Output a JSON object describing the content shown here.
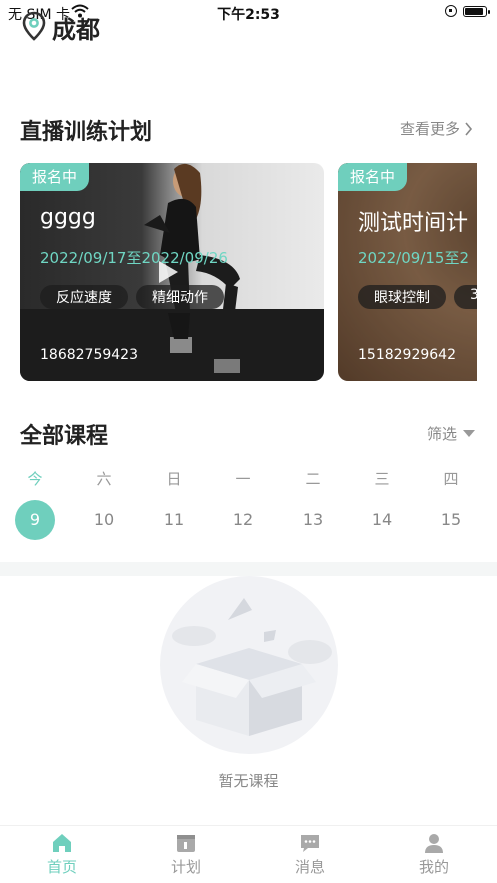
{
  "status_bar": {
    "carrier": "无 SIM 卡",
    "time": "下午2:53",
    "battery_level": 0.9
  },
  "header": {
    "city": "成都",
    "city_icon": "location-pin-icon"
  },
  "live_section": {
    "title": "直播训练计划",
    "see_more": "查看更多",
    "cards": [
      {
        "badge": "报名中",
        "title": "gggg",
        "date": "2022/09/17至2022/09/26",
        "tags": [
          "反应速度",
          "精细动作"
        ],
        "phone": "18682759423"
      },
      {
        "badge": "报名中",
        "title": "测试时间计",
        "date": "2022/09/15至2",
        "tags": [
          "眼球控制",
          "3"
        ],
        "phone": "15182929642"
      }
    ]
  },
  "courses_section": {
    "title": "全部课程",
    "filter": "筛选"
  },
  "calendar": {
    "weekdays": [
      "今",
      "六",
      "日",
      "一",
      "二",
      "三",
      "四"
    ],
    "dates": [
      "9",
      "10",
      "11",
      "12",
      "13",
      "14",
      "15"
    ],
    "selected_index": 0
  },
  "empty_state": {
    "text": "暂无课程"
  },
  "tabbar": {
    "tabs": [
      {
        "label": "首页",
        "icon": "home-icon",
        "active": true
      },
      {
        "label": "计划",
        "icon": "calendar-icon",
        "active": false
      },
      {
        "label": "消息",
        "icon": "message-icon",
        "active": false
      },
      {
        "label": "我的",
        "icon": "profile-icon",
        "active": false
      }
    ]
  },
  "colors": {
    "accent": "#6fcfbd",
    "muted_text": "#888888",
    "band": "#f4f6f6"
  }
}
